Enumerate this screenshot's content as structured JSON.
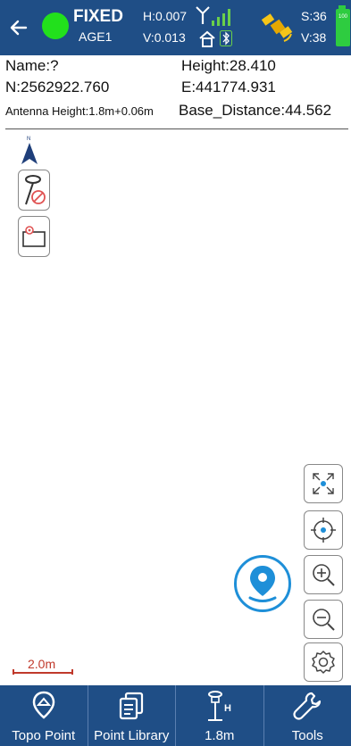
{
  "header": {
    "fix_status": "FIXED",
    "age": "AGE1",
    "h_precision": "H:0.007",
    "v_precision": "V:0.013",
    "satellites_s": "S:36",
    "satellites_v": "V:38",
    "battery": "100",
    "fix_color": "#22e01c",
    "bar_color": "#1f4e86"
  },
  "info": {
    "name": "Name:?",
    "height": "Height:28.410",
    "north": "N:2562922.760",
    "east": "E:441774.931",
    "antenna_height": "Antenna Height:1.8m+0.06m",
    "base_distance": "Base_Distance:44.562"
  },
  "map": {
    "scale_label": "2.0m"
  },
  "bottom_nav": {
    "items": [
      {
        "label": "Topo Point",
        "icon": "topo-point-icon"
      },
      {
        "label": "Point Library",
        "icon": "point-library-icon"
      },
      {
        "label": "1.8m",
        "icon": "antenna-height-icon"
      },
      {
        "label": "Tools",
        "icon": "wrench-icon"
      }
    ]
  }
}
